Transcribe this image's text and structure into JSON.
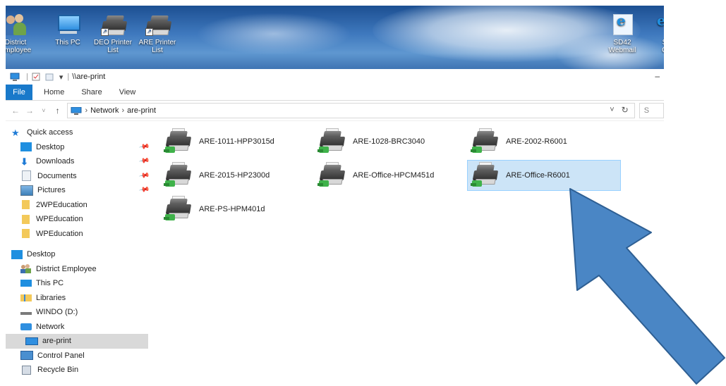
{
  "desktop": {
    "icons": [
      {
        "label1": "District",
        "label2": "Employee"
      },
      {
        "label1": "This PC",
        "label2": ""
      },
      {
        "label1": "DEO Printer",
        "label2": "List"
      },
      {
        "label1": "ARE Printer",
        "label2": "List"
      },
      {
        "label1": "SD42",
        "label2": "Webmail"
      },
      {
        "label1": "S",
        "label2": "O"
      }
    ]
  },
  "window": {
    "title": "\\\\are-print",
    "minimize": "–",
    "ribbon": {
      "file": "File",
      "tabs": [
        "Home",
        "Share",
        "View"
      ]
    },
    "address": {
      "back": "←",
      "forward": "→",
      "recent": "˅",
      "up": "↑",
      "crumbs": [
        "Network",
        "are-print"
      ],
      "separator": "›",
      "dropdown": "˅",
      "refresh": "↻",
      "search_placeholder": "S"
    }
  },
  "sidebar": {
    "quick_access": "Quick access",
    "pinned": [
      "Desktop",
      "Downloads",
      "Documents",
      "Pictures"
    ],
    "folders": [
      "2WPEducation",
      "WPEducation",
      "WPEducation"
    ],
    "tree": {
      "desktop": "Desktop",
      "items": [
        "District Employee",
        "This PC",
        "Libraries",
        "WINDO (D:)",
        "Network"
      ],
      "selected": "are-print",
      "after": [
        "Control Panel",
        "Recycle Bin"
      ]
    }
  },
  "printers": [
    {
      "name": "ARE-1011-HPP3015d",
      "selected": false
    },
    {
      "name": "ARE-1028-BRC3040",
      "selected": false
    },
    {
      "name": "ARE-2002-R6001",
      "selected": false
    },
    {
      "name": "ARE-2015-HP2300d",
      "selected": false
    },
    {
      "name": "ARE-Office-HPCM451d",
      "selected": false
    },
    {
      "name": "ARE-Office-R6001",
      "selected": true
    },
    {
      "name": "ARE-PS-HPM401d",
      "selected": false
    }
  ],
  "annotation": {
    "arrow_color": "#4a86c5",
    "arrow_outline": "#2e5f93"
  }
}
